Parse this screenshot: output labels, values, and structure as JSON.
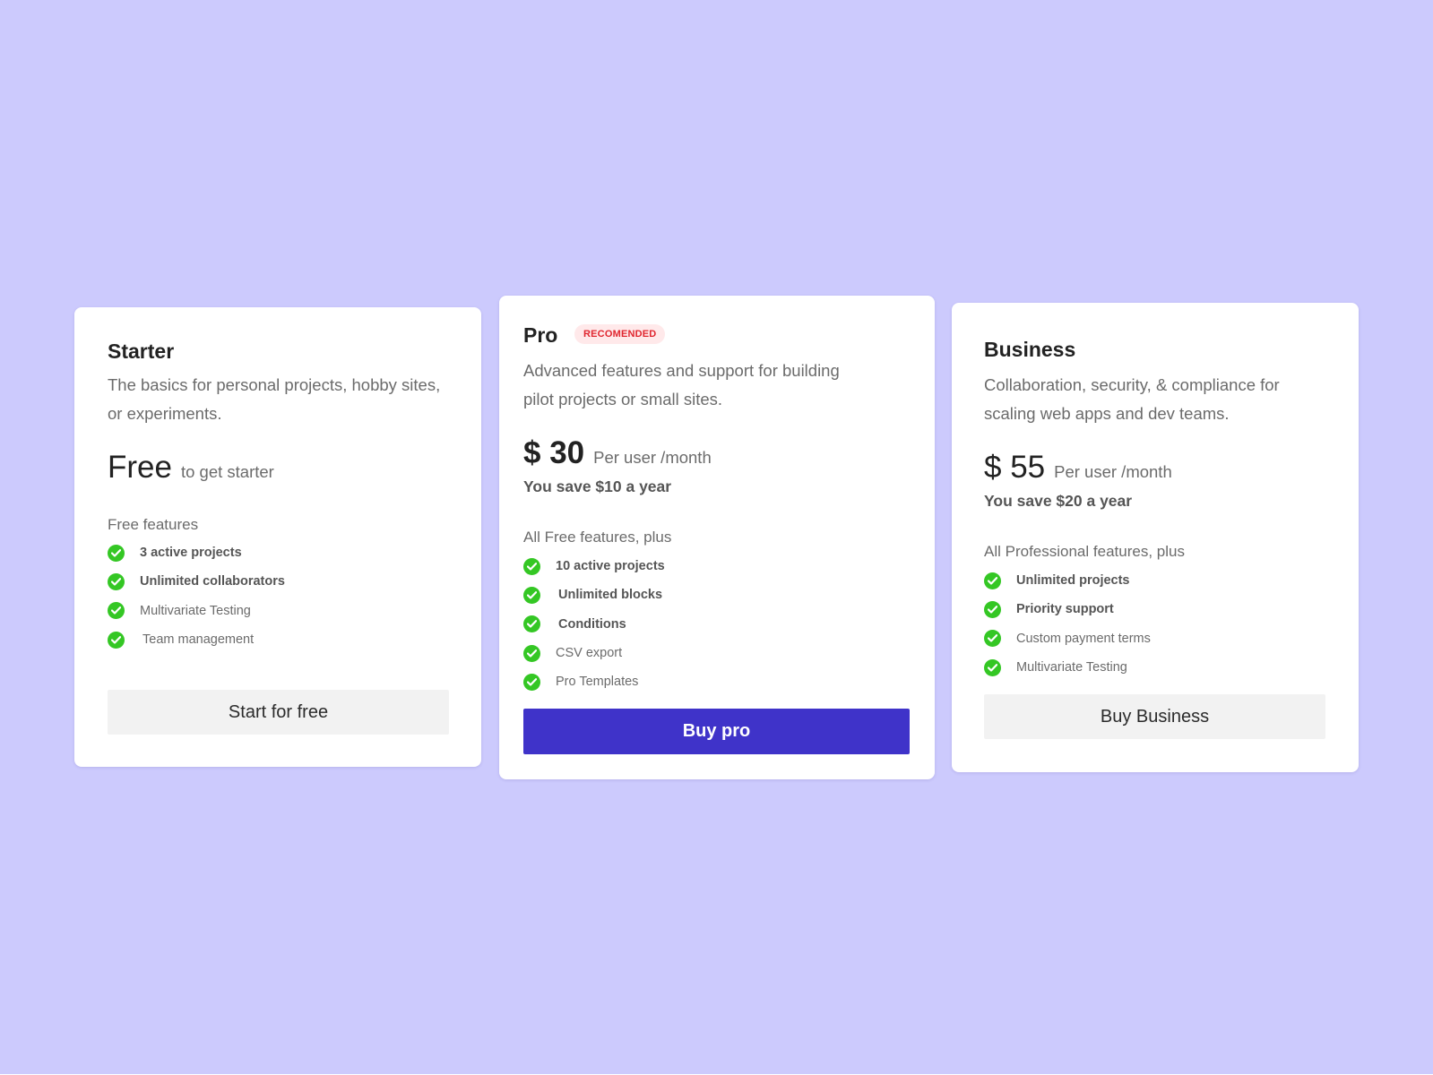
{
  "colors": {
    "background": "#cccafd",
    "card": "#ffffff",
    "accent": "#3f33c9",
    "check": "#34c724",
    "badge_text": "#e0262f",
    "badge_bg": "#ffe9ea",
    "secondary_button": "#f2f2f2"
  },
  "plans": {
    "starter": {
      "name": "Starter",
      "description": "The basics for personal projects, hobby sites, or experiments.",
      "price": "Free",
      "price_suffix": "to get starter",
      "features_heading": "Free features",
      "features": [
        {
          "text": "3 active projects",
          "icon": "check-circle-icon"
        },
        {
          "text": "Unlimited collaborators",
          "icon": "check-circle-icon"
        },
        {
          "text": "Multivariate Testing",
          "icon": "check-circle-icon"
        },
        {
          "text": "Team management",
          "icon": "check-circle-icon"
        }
      ],
      "cta": "Start for free"
    },
    "pro": {
      "name": "Pro",
      "badge": "RECOMENDED",
      "description": "Advanced features and support for building pilot projects or small sites.",
      "price": "$ 30",
      "price_suffix": "Per user /month",
      "savings": "You save $10 a year",
      "features_heading": "All Free features, plus",
      "features": [
        {
          "text": "10 active projects",
          "icon": "check-circle-icon"
        },
        {
          "text": "Unlimited blocks",
          "icon": "check-circle-icon"
        },
        {
          "text": "Conditions",
          "icon": "check-circle-icon"
        },
        {
          "text": "CSV export",
          "icon": "check-circle-icon"
        },
        {
          "text": "Pro Templates",
          "icon": "check-circle-icon"
        }
      ],
      "cta": "Buy pro"
    },
    "business": {
      "name": "Business",
      "description": "Collaboration, security, & compliance for scaling web apps and dev teams.",
      "price": "$ 55",
      "price_suffix": "Per user /month",
      "savings": "You save $20 a year",
      "features_heading": "All Professional features, plus",
      "features": [
        {
          "text": "Unlimited projects",
          "icon": "check-circle-icon"
        },
        {
          "text": "Priority support",
          "icon": "check-circle-icon"
        },
        {
          "text": "Custom payment terms",
          "icon": "check-circle-icon"
        },
        {
          "text": "Multivariate Testing",
          "icon": "check-circle-icon"
        }
      ],
      "cta": "Buy Business"
    }
  }
}
